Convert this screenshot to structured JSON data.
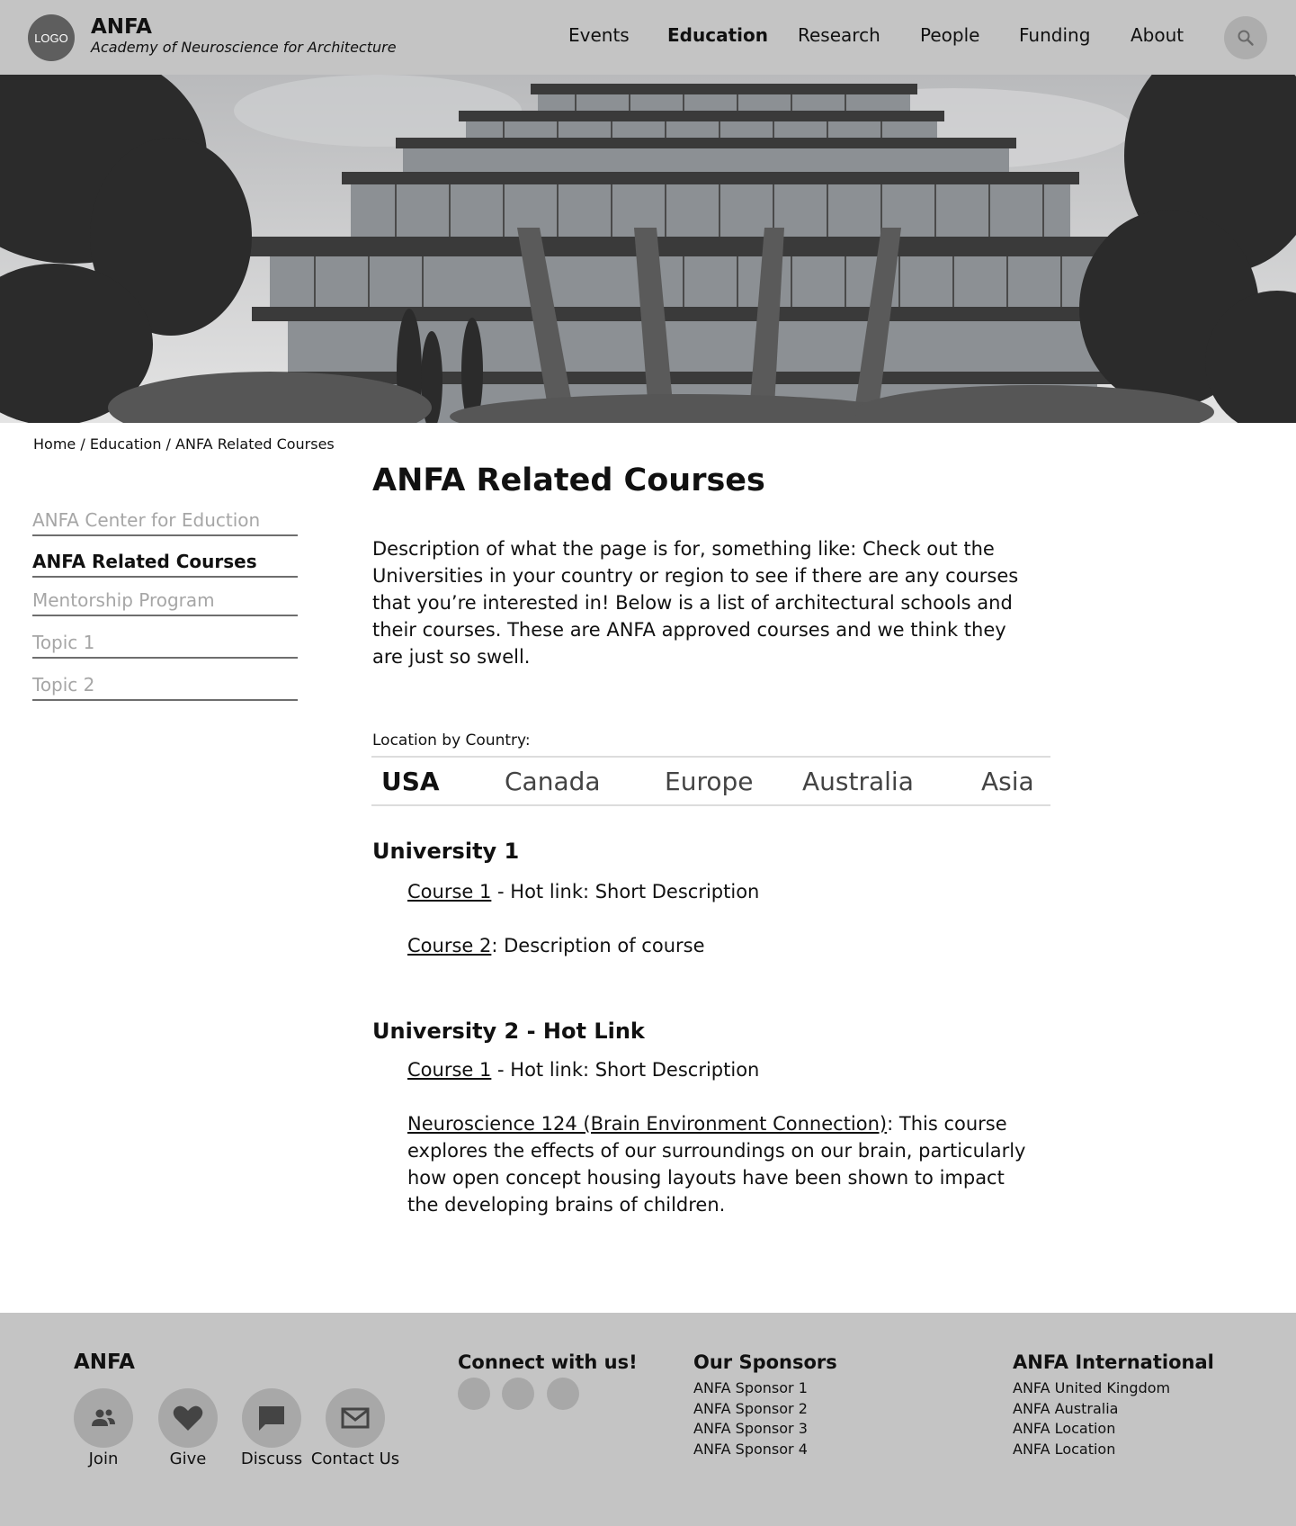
{
  "header": {
    "logo_text": "LOGO",
    "brand_name": "ANFA",
    "brand_subtitle": "Academy of Neuroscience for Architecture",
    "nav": [
      "Events",
      "Education",
      "Research",
      "People",
      "Funding",
      "About"
    ],
    "active_nav": "Education",
    "search_icon": "search-icon"
  },
  "breadcrumb": {
    "items": [
      "Home",
      "Education",
      "ANFA Related Courses"
    ],
    "separator": " / "
  },
  "sidebar": {
    "items": [
      {
        "label": "ANFA Center for Eduction"
      },
      {
        "label": "ANFA Related Courses"
      },
      {
        "label": "Mentorship Program"
      },
      {
        "label": "Topic 1"
      },
      {
        "label": "Topic 2"
      }
    ],
    "active": "ANFA Related Courses"
  },
  "main": {
    "title": "ANFA Related Courses",
    "description": "Description of what the page is for, something like: Check out the Universities in your country or region to see if there are any courses that you’re interested in! Below is a list of architectural schools and their courses. These are ANFA approved courses and we think they are just so swell.",
    "location_label": "Location by Country:",
    "tabs": [
      "USA",
      "Canada",
      "Europe",
      "Australia",
      "Asia"
    ],
    "active_tab": "USA",
    "universities": [
      {
        "name": "University 1",
        "courses": [
          {
            "link": "Course 1",
            "text": " - Hot link: Short Description"
          },
          {
            "link": "Course 2",
            "text": ": Description of course"
          }
        ]
      },
      {
        "name": "University 2 - Hot Link",
        "courses": [
          {
            "link": "Course 1",
            "text": " - Hot link: Short Description"
          },
          {
            "link": "Neuroscience 124 (Brain Environment Connection)",
            "text": ": This course explores the effects of our surroundings on our brain, particularly how open concept housing layouts have been shown to impact the developing brains of children."
          }
        ]
      }
    ]
  },
  "footer": {
    "brand": "ANFA",
    "actions": [
      {
        "label": "Join",
        "icon": "people-icon"
      },
      {
        "label": "Give",
        "icon": "heart-icon"
      },
      {
        "label": "Discuss",
        "icon": "chat-icon"
      },
      {
        "label": "Contact Us",
        "icon": "mail-icon"
      }
    ],
    "connect_heading": "Connect with us!",
    "sponsors_heading": "Our Sponsors",
    "sponsors": [
      "ANFA Sponsor 1",
      "ANFA Sponsor 2",
      "ANFA Sponsor 3",
      "ANFA Sponsor 4"
    ],
    "international_heading": "ANFA International",
    "international": [
      "ANFA United Kingdom",
      "ANFA Australia",
      "ANFA Location",
      "ANFA Location"
    ]
  },
  "colors": {
    "header_bg": "#c4c4c4",
    "footer_bg": "#c4c4c4",
    "logo_bg": "#5e5e5e",
    "inactive_text": "#a6a6a6"
  }
}
